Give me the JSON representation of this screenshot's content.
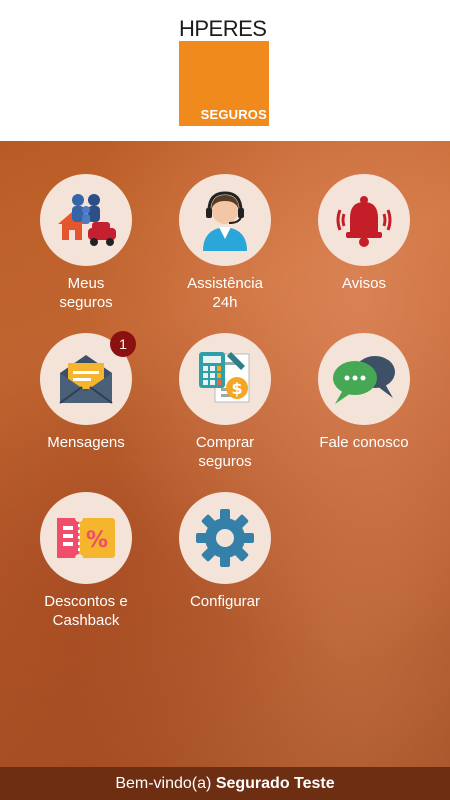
{
  "brand": {
    "top": "HPERES",
    "sub": "SEGUROS"
  },
  "menu": [
    {
      "id": "meus-seguros",
      "label": "Meus\nseguros",
      "icon": "family-house-car-icon"
    },
    {
      "id": "assistencia",
      "label": "Assistência\n24h",
      "icon": "support-agent-icon"
    },
    {
      "id": "avisos",
      "label": "Avisos",
      "icon": "bell-icon"
    },
    {
      "id": "mensagens",
      "label": "Mensagens",
      "icon": "envelope-icon",
      "badge": "1"
    },
    {
      "id": "comprar-seguros",
      "label": "Comprar\nseguros",
      "icon": "calculator-document-icon"
    },
    {
      "id": "fale-conosco",
      "label": "Fale conosco",
      "icon": "chat-bubbles-icon"
    },
    {
      "id": "descontos",
      "label": "Descontos e\nCashback",
      "icon": "discount-ticket-icon"
    },
    {
      "id": "configurar",
      "label": "Configurar",
      "icon": "gear-icon"
    }
  ],
  "footer": {
    "greeting": "Bem-vindo(a)",
    "user": "Segurado Teste"
  },
  "colors": {
    "brand_orange": "#f08a1c",
    "footer_bg": "#6e2e12",
    "badge": "#8b1010"
  }
}
